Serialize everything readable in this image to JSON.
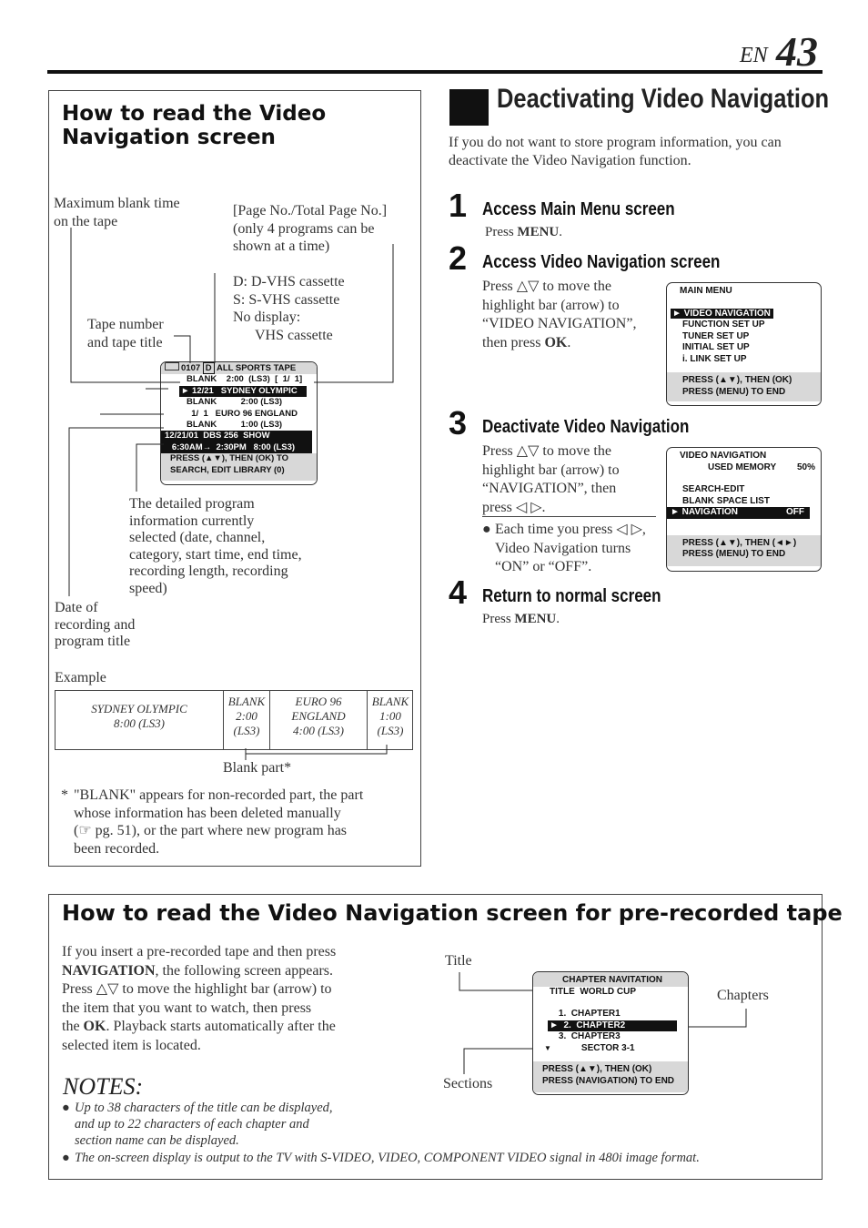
{
  "header": {
    "lang": "EN",
    "page_number": "43"
  },
  "left_panel": {
    "title_line1": "How to read the Video",
    "title_line2": "Navigation screen",
    "callouts": {
      "max_blank": [
        "Maximum blank time",
        "on the tape"
      ],
      "page_no": [
        "[Page No./Total Page No.]",
        "(only 4 programs can be",
        "shown at a time)"
      ],
      "cassette": [
        "D: D-VHS cassette",
        "S:  S-VHS cassette",
        "No display:",
        "VHS cassette"
      ],
      "tape_number": [
        "Tape number",
        "and tape title"
      ],
      "detailed": [
        "The detailed program",
        "information currently",
        "selected (date, channel,",
        "category, start time, end time,",
        "recording length, recording",
        "speed)"
      ],
      "date_of": [
        "Date of",
        "recording and",
        "program title"
      ]
    },
    "osd": {
      "tape_no": "0107",
      "cassette_type": "D",
      "tape_title": "ALL SPORTS TAPE",
      "rows": [
        "BLANK    2:00  (LS3)  [  1/  1]",
        "► 12/21   SYDNEY OLYMPIC",
        "BLANK          2:00 (LS3)",
        "  1/  1   EURO 96 ENGLAND",
        "BLANK          1:00 (LS3)"
      ],
      "detail1": "12/21/01  DBS 256  SHOW",
      "detail2": "   6:30AM→  2:30PM   8:00 (LS3)",
      "foot1": "PRESS (▲▼), THEN (OK) TO",
      "foot2": "SEARCH, EDIT LIBRARY (0)"
    },
    "example_label": "Example",
    "example_cells": [
      [
        "SYDNEY  OLYMPIC",
        "8:00 (LS3)"
      ],
      [
        "BLANK",
        "2:00",
        "(LS3)"
      ],
      [
        "EURO 96",
        "ENGLAND",
        "4:00 (LS3)"
      ],
      [
        "BLANK",
        "1:00",
        "(LS3)"
      ]
    ],
    "blank_part": "Blank part*",
    "footnote_mark": "*",
    "footnote": [
      "\"BLANK\" appears for non-recorded part, the part",
      "whose information has been deleted manually",
      "(☞ pg. 51), or the part where new program has",
      "been recorded."
    ]
  },
  "right": {
    "title": "Deactivating Video Navigation",
    "intro": [
      "If you do not want to store program information, you can",
      "deactivate the Video Navigation function."
    ],
    "steps": [
      {
        "num": "1",
        "title": "Access Main Menu screen",
        "text": [
          "Press ",
          "MENU",
          "."
        ]
      },
      {
        "num": "2",
        "title": "Access Video Navigation screen",
        "lines": [
          "Press △▽ to move the",
          "highlight bar (arrow) to",
          "“VIDEO NAVIGATION”,",
          "then press "
        ],
        "bold": "OK",
        "end": "."
      },
      {
        "num": "3",
        "title": "Deactivate Video Navigation",
        "lines": [
          "Press △▽ to move the",
          "highlight bar (arrow) to",
          "“NAVIGATION”, then",
          "press ◁ ▷."
        ],
        "bullet": [
          "Each time you press ◁ ▷,",
          "Video Navigation turns",
          "“ON” or “OFF”."
        ]
      },
      {
        "num": "4",
        "title": "Return to normal screen",
        "text": [
          "Press ",
          "MENU",
          "."
        ]
      }
    ],
    "main_menu_osd": {
      "title": "MAIN MENU",
      "items": [
        "► VIDEO NAVIGATION",
        "FUNCTION SET UP",
        "TUNER SET UP",
        "INITIAL SET UP",
        "i. LINK SET UP"
      ],
      "foot1": "PRESS (▲▼), THEN (OK)",
      "foot2": "PRESS (MENU) TO END"
    },
    "vn_osd": {
      "title": "VIDEO NAVIGATION",
      "used_memory_label": "USED MEMORY",
      "used_memory": "50%",
      "items": [
        "SEARCH-EDIT",
        "BLANK SPACE LIST"
      ],
      "nav_label": "► NAVIGATION",
      "nav_value": "OFF",
      "foot1": "PRESS (▲▼), THEN (◄►)",
      "foot2": "PRESS (MENU) TO END"
    }
  },
  "bottom": {
    "title": "How to read the Video Navigation screen for pre-recorded tape",
    "body": [
      [
        "If you insert a pre-recorded tape and then press"
      ],
      [
        "",
        "NAVIGATION",
        ", the following screen appears."
      ],
      [
        "Press △▽ to move the highlight bar (arrow) to"
      ],
      [
        "the item that you want to watch, then press"
      ],
      [
        "the ",
        "OK",
        ". Playback starts automatically after the"
      ],
      [
        "selected item is located."
      ]
    ],
    "notes_title": "NOTES:",
    "notes": [
      [
        "Up to 38 characters of the title can be displayed,",
        "and up to 22 characters of each chapter and",
        "section name can be displayed."
      ],
      [
        "The on-screen display is output to the TV with S-VIDEO, VIDEO, COMPONENT VIDEO signal in 480i image format."
      ]
    ],
    "labels": {
      "title": "Title",
      "chapters": "Chapters",
      "sections": "Sections"
    },
    "osd": {
      "header": "CHAPTER NAVITATION",
      "title_row": "TITLE  WORLD CUP",
      "rows": [
        "     1.  CHAPTER1",
        "►  2.  CHAPTER2",
        "     3.  CHAPTER3",
        "              SECTOR 3-1"
      ],
      "foot1": "PRESS (▲▼), THEN (OK)",
      "foot2": "PRESS (NAVIGATION) TO END"
    }
  }
}
